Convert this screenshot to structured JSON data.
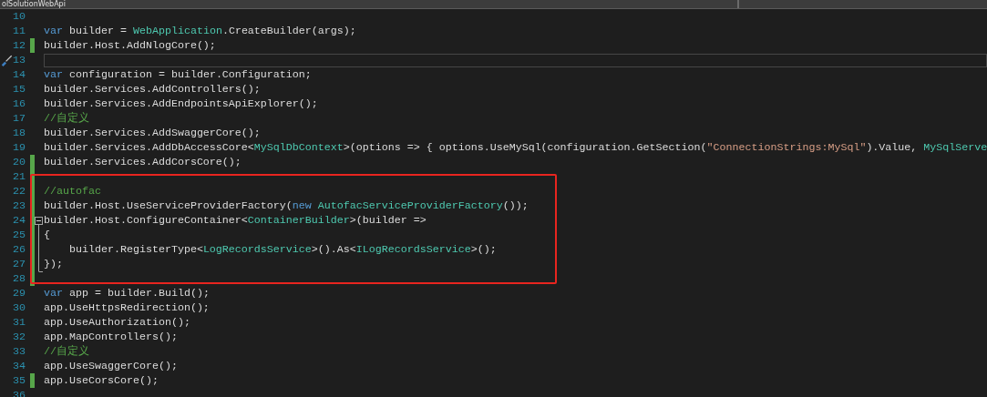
{
  "tab": {
    "label": "olSolutionWebApi"
  },
  "blocks": [
    {
      "lines": [
        {
          "number": "10"
        },
        {
          "number": "11",
          "tokens": [
            {
              "kind": "keyword",
              "text": "var"
            },
            {
              "kind": "plain",
              "text": " builder = "
            },
            {
              "kind": "type",
              "text": "WebApplication"
            },
            {
              "kind": "plain",
              "text": ".CreateBuilder(args);"
            }
          ]
        },
        {
          "number": "12",
          "changed": true,
          "tokens": [
            {
              "kind": "plain",
              "text": "builder.Host.AddNlogCore();"
            }
          ]
        },
        {
          "number": "13",
          "current": true
        },
        {
          "number": "14",
          "tokens": [
            {
              "kind": "keyword",
              "text": "var"
            },
            {
              "kind": "plain",
              "text": " configuration = builder.Configuration;"
            }
          ]
        },
        {
          "number": "15",
          "tokens": [
            {
              "kind": "plain",
              "text": "builder.Services.AddControllers();"
            }
          ]
        },
        {
          "number": "16",
          "tokens": [
            {
              "kind": "plain",
              "text": "builder.Services.AddEndpointsApiExplorer();"
            }
          ]
        },
        {
          "number": "17",
          "tokens": [
            {
              "kind": "comment",
              "text": "//自定义"
            }
          ]
        },
        {
          "number": "18",
          "tokens": [
            {
              "kind": "plain",
              "text": "builder.Services.AddSwaggerCore();"
            }
          ]
        },
        {
          "number": "19",
          "tokens": [
            {
              "kind": "plain",
              "text": "builder.Services.AddDbAccessCore<"
            },
            {
              "kind": "type",
              "text": "MySqlDbContext"
            },
            {
              "kind": "plain",
              "text": ">(options => { options.UseMySql(configuration.GetSection("
            },
            {
              "kind": "string",
              "text": "\"ConnectionStrings:MySql\""
            },
            {
              "kind": "plain",
              "text": ").Value, "
            },
            {
              "kind": "type",
              "text": "MySqlServe"
            }
          ]
        },
        {
          "number": "20",
          "changed": true,
          "tokens": [
            {
              "kind": "plain",
              "text": "builder.Services.AddCorsCore();"
            }
          ]
        }
      ]
    },
    {
      "annotated": true,
      "lines": [
        {
          "number": "21",
          "changed": true
        },
        {
          "number": "22",
          "changed": true,
          "tokens": [
            {
              "kind": "comment",
              "text": "//autofac"
            }
          ]
        },
        {
          "number": "23",
          "changed": true,
          "tokens": [
            {
              "kind": "plain",
              "text": "builder.Host.UseServiceProviderFactory("
            },
            {
              "kind": "keyword",
              "text": "new"
            },
            {
              "kind": "type",
              "text": " AutofacServiceProviderFactory"
            },
            {
              "kind": "plain",
              "text": "());"
            }
          ]
        },
        {
          "number": "24",
          "changed": true,
          "fold": {
            "expanded": true
          },
          "tokens": [
            {
              "kind": "plain",
              "text": "builder.Host.ConfigureContainer<"
            },
            {
              "kind": "type",
              "text": "ContainerBuilder"
            },
            {
              "kind": "plain",
              "text": ">(builder =>"
            }
          ]
        },
        {
          "number": "25",
          "changed": true,
          "tokens": [
            {
              "kind": "plain",
              "text": "{"
            }
          ]
        },
        {
          "number": "26",
          "changed": true,
          "tokens": [
            {
              "kind": "plain",
              "text": "    builder.RegisterType<"
            },
            {
              "kind": "type",
              "text": "LogRecordsService"
            },
            {
              "kind": "plain",
              "text": ">().As<"
            },
            {
              "kind": "type",
              "text": "ILogRecordsService"
            },
            {
              "kind": "plain",
              "text": ">();"
            }
          ]
        },
        {
          "number": "27",
          "changed": true,
          "tokens": [
            {
              "kind": "plain",
              "text": "});"
            }
          ]
        },
        {
          "number": "28",
          "changed": true
        }
      ]
    },
    {
      "lines": [
        {
          "number": "29",
          "tokens": [
            {
              "kind": "keyword",
              "text": "var"
            },
            {
              "kind": "plain",
              "text": " app = builder.Build();"
            }
          ]
        },
        {
          "number": "30",
          "tokens": [
            {
              "kind": "plain",
              "text": "app.UseHttpsRedirection();"
            }
          ]
        },
        {
          "number": "31",
          "tokens": [
            {
              "kind": "plain",
              "text": "app.UseAuthorization();"
            }
          ]
        },
        {
          "number": "32",
          "tokens": [
            {
              "kind": "plain",
              "text": "app.MapControllers();"
            }
          ]
        },
        {
          "number": "33",
          "tokens": [
            {
              "kind": "comment",
              "text": "//自定义"
            }
          ]
        },
        {
          "number": "34",
          "tokens": [
            {
              "kind": "plain",
              "text": "app.UseSwaggerCore();"
            }
          ]
        },
        {
          "number": "35",
          "changed": true,
          "tokens": [
            {
              "kind": "plain",
              "text": "app.UseCorsCore();"
            }
          ]
        },
        {
          "number": "36"
        }
      ]
    }
  ]
}
